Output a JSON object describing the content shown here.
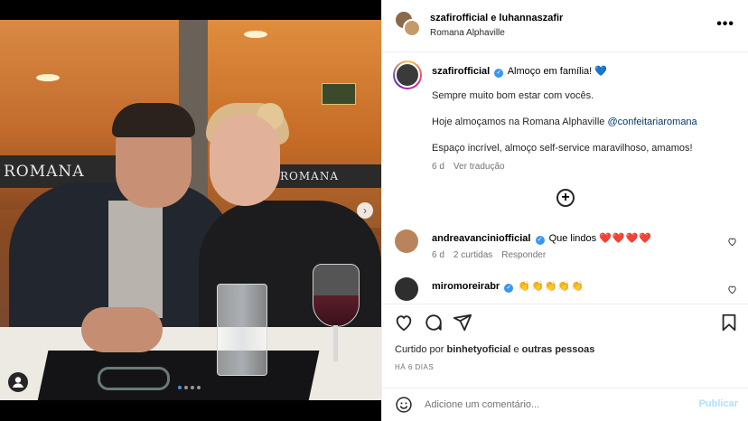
{
  "post": {
    "carousel": {
      "slide_count": 4,
      "current_slide": 1
    },
    "header": {
      "user_a": "szafirofficial",
      "connector": " e ",
      "user_b": "luhannaszafir",
      "location": "Romana Alphaville"
    },
    "caption": {
      "author": "szafirofficial",
      "title": "Almoço em família!",
      "title_emoji": "💙",
      "line1": "Sempre muito bom estar com vocês.",
      "line2_prefix": "Hoje almoçamos na Romana Alphaville",
      "line2_mention": "@confeitariaromana",
      "line3": "Espaço incrível, almoço self-service maravilhoso, amamos!",
      "age": "6 d",
      "translate": "Ver tradução"
    },
    "photo_signs": {
      "left": "ROMANA",
      "right": "ROMANA"
    },
    "comments": [
      {
        "user": "andreavanciniofficial",
        "text": "Que lindos",
        "emoji": "❤️❤️❤️❤️",
        "age": "6 d",
        "likes": "2 curtidas",
        "reply": "Responder"
      },
      {
        "user": "miromoreirabr",
        "text": "",
        "emoji": "👏👏👏👏👏",
        "age": "",
        "likes": "",
        "reply": ""
      }
    ],
    "likes": {
      "prefix": "Curtido por",
      "by": "binhetyoficial",
      "joiner": "e",
      "others": "outras pessoas"
    },
    "timestamp": "HÁ 6 DIAS",
    "comment_box": {
      "placeholder": "Adicione um comentário...",
      "publish": "Publicar"
    },
    "icons": {
      "more": "more-horizontal-icon",
      "like": "heart-outline-icon",
      "comment": "speech-bubble-icon",
      "share": "paper-plane-icon",
      "save": "bookmark-icon",
      "emoji": "smiley-icon",
      "load_more": "plus-circle-icon",
      "next": "chevron-right-icon",
      "tagged": "user-tag-icon"
    },
    "colors": {
      "verified": "#3897f0",
      "mention": "#00376b",
      "muted": "#737373",
      "publish_disabled": "#b2dffc"
    }
  }
}
